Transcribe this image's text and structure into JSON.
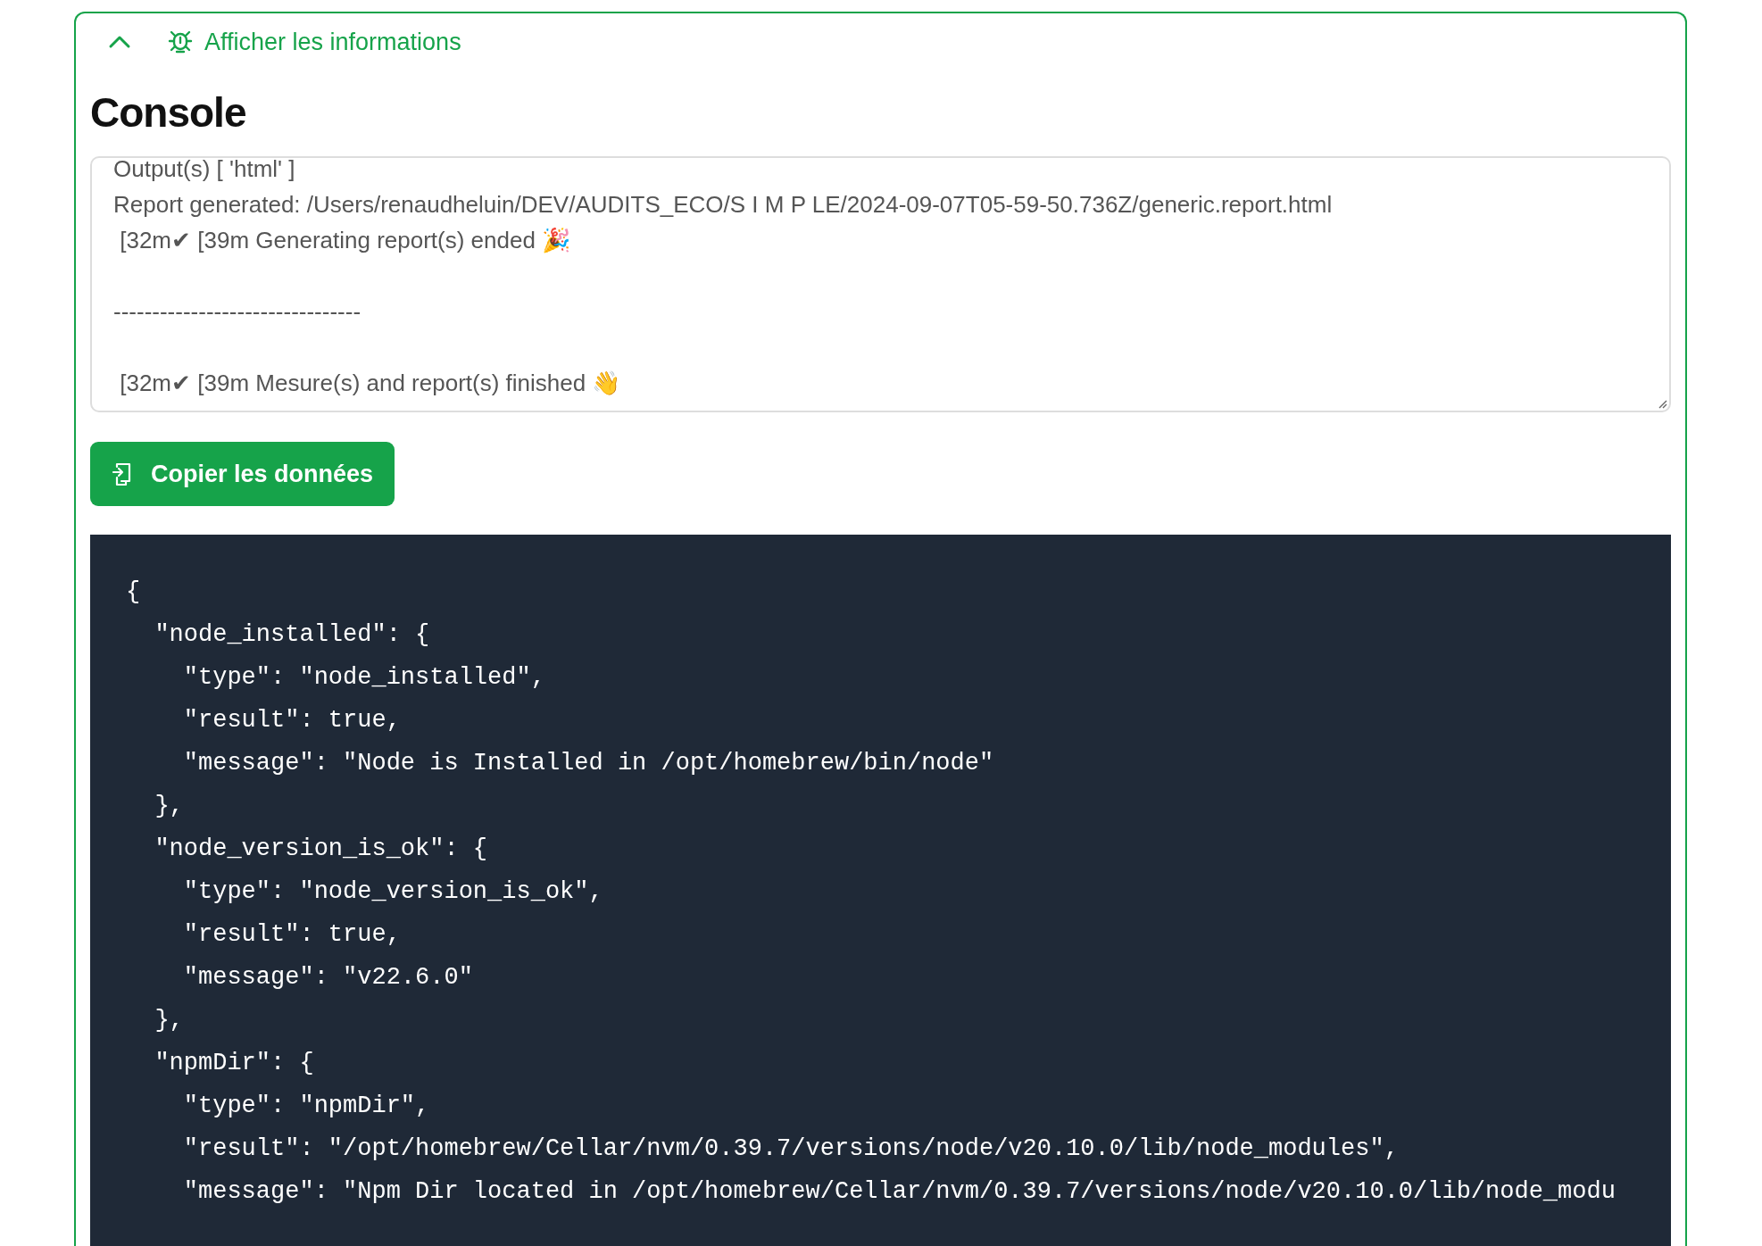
{
  "panel": {
    "toggle_label": "Afficher les informations",
    "expanded": true
  },
  "title": "Console",
  "console_lines": [
    {
      "kind": "line",
      "text": "Output(s) [ 'html' ]"
    },
    {
      "kind": "line",
      "text": "Report generated: /Users/renaudheluin/DEV/AUDITS_ECO/S I M P LE/2024-09-07T05-59-50.736Z/generic.report.html"
    },
    {
      "kind": "line",
      "text": " [32m✔ [39m Generating report(s) ended 🎉"
    },
    {
      "kind": "separator",
      "text": "--------------------------------"
    },
    {
      "kind": "line",
      "text": " [32m✔ [39m Mesure(s) and report(s) finished 👋"
    }
  ],
  "copy_button": "Copier les données",
  "code_lines": [
    "{",
    "  \"node_installed\": {",
    "    \"type\": \"node_installed\",",
    "    \"result\": true,",
    "    \"message\": \"Node is Installed in /opt/homebrew/bin/node\"",
    "  },",
    "  \"node_version_is_ok\": {",
    "    \"type\": \"node_version_is_ok\",",
    "    \"result\": true,",
    "    \"message\": \"v22.6.0\"",
    "  },",
    "  \"npmDir\": {",
    "    \"type\": \"npmDir\",",
    "    \"result\": \"/opt/homebrew/Cellar/nvm/0.39.7/versions/node/v20.10.0/lib/node_modules\",",
    "    \"message\": \"Npm Dir located in /opt/homebrew/Cellar/nvm/0.39.7/versions/node/v20.10.0/lib/node_modu"
  ]
}
